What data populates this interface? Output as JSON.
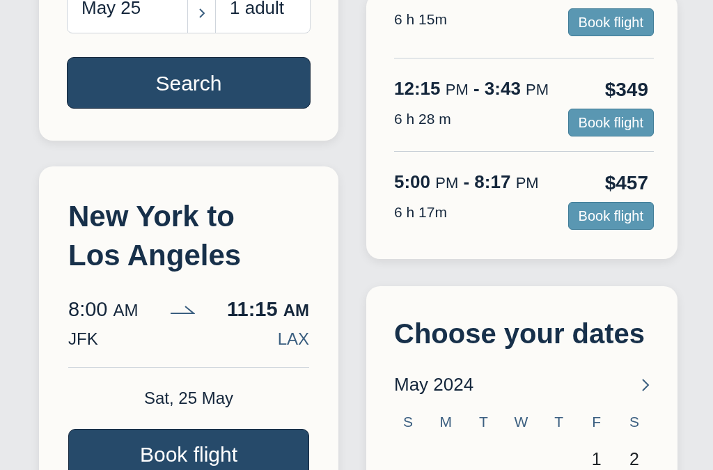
{
  "search_card": {
    "date": "May 25",
    "passengers": "1 adult",
    "button": "Search"
  },
  "flight_card": {
    "title": "New York to Los Angeles",
    "depart": {
      "time": "8:00",
      "period": "AM",
      "airport": "JFK"
    },
    "arrive": {
      "time": "11:15",
      "period": "AM",
      "airport": "LAX"
    },
    "date": "Sat, 25 May",
    "button": "Book flight"
  },
  "results": [
    {
      "duration": "6 h 15m",
      "button": "Book flight"
    },
    {
      "depart_time": "12:15",
      "depart_period": "PM",
      "dash": "-",
      "arrive_time": "3:43",
      "arrive_period": "PM",
      "price": "$349",
      "duration": "6 h 28 m",
      "button": "Book flight"
    },
    {
      "depart_time": "5:00",
      "depart_period": "PM",
      "dash": "-",
      "arrive_time": "8:17",
      "arrive_period": "PM",
      "price": "$457",
      "duration": "6 h 17m",
      "button": "Book flight"
    }
  ],
  "calendar": {
    "title": "Choose your dates",
    "month": "May 2024",
    "weekdays": [
      "S",
      "M",
      "T",
      "W",
      "T",
      "F",
      "S"
    ],
    "weeks": [
      {
        "days": [
          "1",
          "2"
        ]
      }
    ]
  }
}
